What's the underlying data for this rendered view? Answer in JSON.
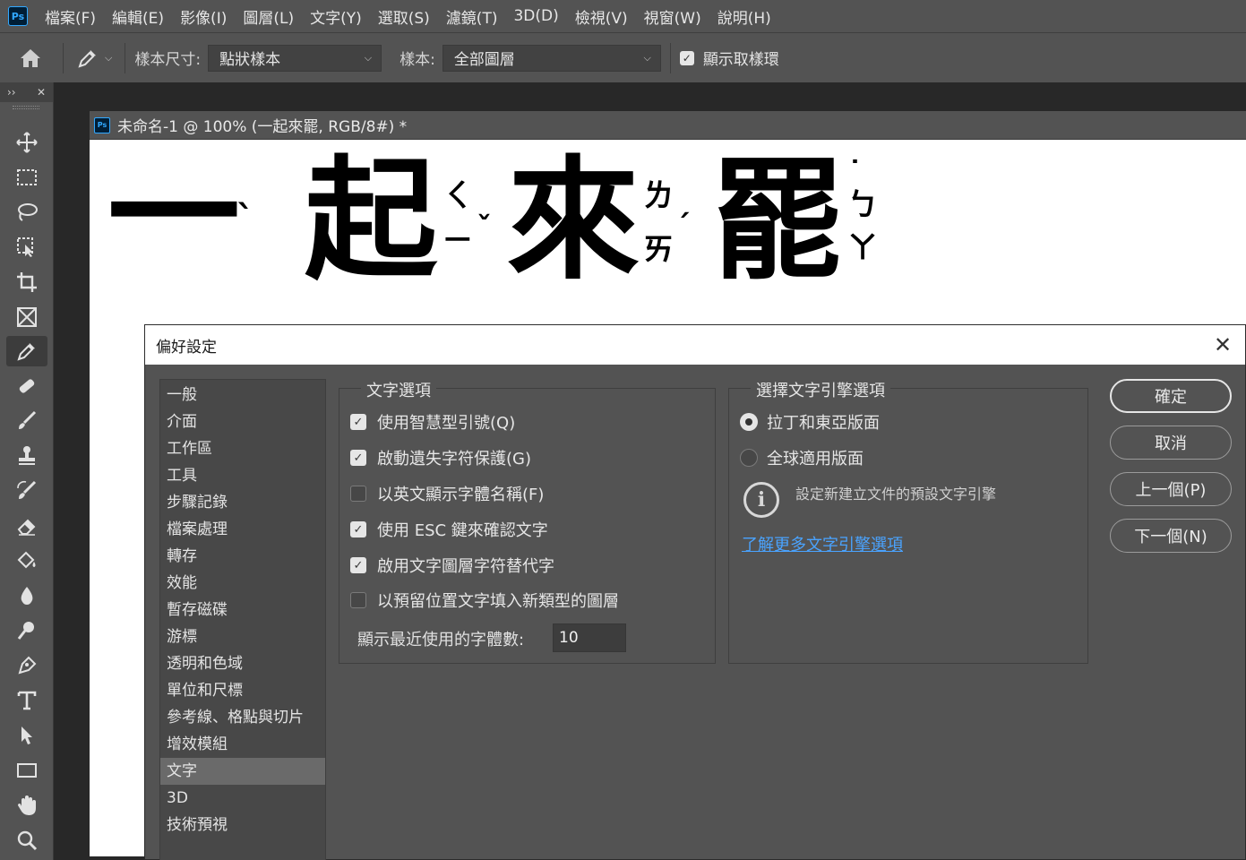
{
  "menu": {
    "logo": "Ps",
    "items": [
      "檔案(F)",
      "編輯(E)",
      "影像(I)",
      "圖層(L)",
      "文字(Y)",
      "選取(S)",
      "濾鏡(T)",
      "3D(D)",
      "檢視(V)",
      "視窗(W)",
      "說明(H)"
    ]
  },
  "options": {
    "sample_size_label": "樣本尺寸:",
    "sample_size_value": "點狀樣本",
    "sample_label": "樣本:",
    "sample_value": "全部圖層",
    "show_ring_label": "顯示取樣環",
    "show_ring_checked": true
  },
  "toolpanel": {
    "collapse": "››",
    "close": "✕"
  },
  "document": {
    "tab_title": "未命名-1 @ 100% (一起來罷, RGB/8#) *",
    "chars": [
      "一",
      "起",
      "來",
      "罷"
    ],
    "bopomofo": [
      "ˋ",
      "ㄑ",
      "ㄧ",
      "ˇ",
      "ㄌ",
      "ㄞ",
      "ˊ",
      "˙",
      "ㄅ",
      "ㄚ"
    ]
  },
  "dialog": {
    "title": "偏好設定",
    "close": "✕",
    "categories": [
      "一般",
      "介面",
      "工作區",
      "工具",
      "步驟記錄",
      "檔案處理",
      "轉存",
      "效能",
      "暫存磁碟",
      "游標",
      "透明和色域",
      "單位和尺標",
      "參考線、格點與切片",
      "增效模組",
      "文字",
      "3D",
      "技術預視"
    ],
    "selected_category": 14,
    "text_options": {
      "legend": "文字選項",
      "checkboxes": [
        {
          "label": "使用智慧型引號(Q)",
          "checked": true
        },
        {
          "label": "啟動遺失字符保護(G)",
          "checked": true
        },
        {
          "label": "以英文顯示字體名稱(F)",
          "checked": false
        },
        {
          "label": "使用 ESC 鍵來確認文字",
          "checked": true
        },
        {
          "label": "啟用文字圖層字符替代字",
          "checked": true
        },
        {
          "label": "以預留位置文字填入新類型的圖層",
          "checked": false
        }
      ],
      "recent_fonts_label": "顯示最近使用的字體數:",
      "recent_fonts_value": "10"
    },
    "engine_options": {
      "legend": "選擇文字引擎選項",
      "radios": [
        {
          "label": "拉丁和東亞版面",
          "selected": true
        },
        {
          "label": "全球適用版面",
          "selected": false
        }
      ],
      "info": "設定新建立文件的預設文字引擎",
      "link": "了解更多文字引擎選項"
    },
    "buttons": {
      "ok": "確定",
      "cancel": "取消",
      "prev": "上一個(P)",
      "next": "下一個(N)"
    }
  }
}
